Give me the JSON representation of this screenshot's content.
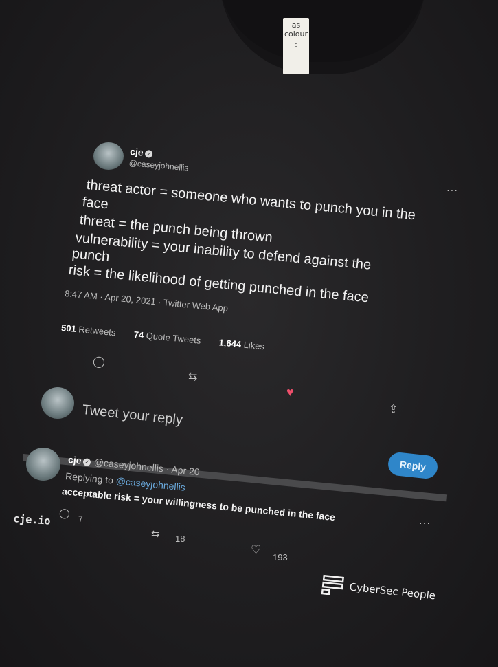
{
  "tag": {
    "brand": "as colour",
    "size": "S"
  },
  "tweet": {
    "name": "cje",
    "handle": "@caseyjohnellis",
    "lines": [
      "threat actor = someone who wants to punch you in the",
      "face",
      "threat = the punch being thrown",
      "vulnerability = your inability to defend against the",
      "punch",
      "risk = the likelihood of getting punched in the face"
    ],
    "timestamp": "8:47 AM · Apr 20, 2021 · Twitter Web App",
    "retweets_count": "501",
    "retweets_label": "Retweets",
    "quotes_count": "74",
    "quotes_label": "Quote Tweets",
    "likes_count": "1,644",
    "likes_label": "Likes",
    "more": "···"
  },
  "reply_box": {
    "placeholder": "Tweet your reply",
    "button": "Reply"
  },
  "reply": {
    "name": "cje",
    "handle_date": "@caseyjohnellis · Apr 20",
    "replying_prefix": "Replying to",
    "replying_to": "@caseyjohnellis",
    "text": "acceptable risk = your willingness to be punched in the face",
    "comments": "7",
    "retweets": "18",
    "likes": "193",
    "more": "···"
  },
  "footer": {
    "site": "cje.io",
    "logo_text": "CyberSec People"
  },
  "colors": {
    "shirt": "#1f1e20",
    "accent": "#2f86c9",
    "heart": "#ef4f6b",
    "link": "#6aa9dc"
  }
}
